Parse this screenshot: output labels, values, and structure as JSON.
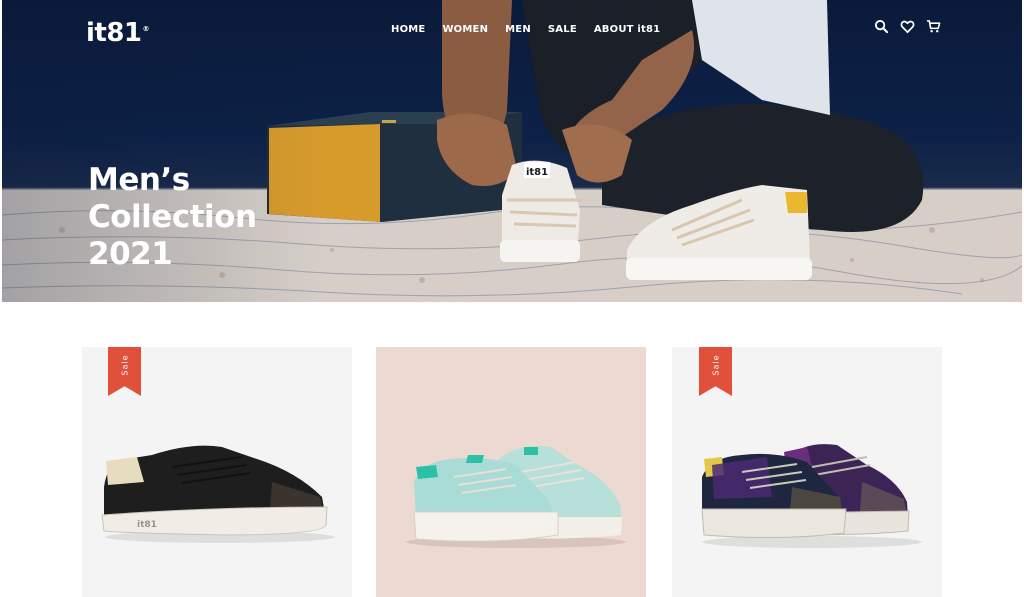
{
  "brand": {
    "logo": "it81",
    "reg": "®"
  },
  "nav": {
    "items": [
      {
        "label": "HOME"
      },
      {
        "label": "WOMEN"
      },
      {
        "label": "MEN"
      },
      {
        "label": "SALE"
      },
      {
        "label": "ABOUT it81"
      }
    ]
  },
  "header_icons": [
    "search-icon",
    "heart-icon",
    "cart-icon"
  ],
  "hero": {
    "title_line1": "Men’s",
    "title_line2": "Collection",
    "title_line3": "2021",
    "shoe_tag": "it81"
  },
  "products": [
    {
      "badge": "Sale",
      "shoe_tag": "it81",
      "colors": {
        "bg": "#f4f4f4",
        "upper": "#1e1e1e"
      }
    },
    {
      "badge": "",
      "colors": {
        "bg": "#ecd9d2",
        "upper": "#a9dcd6"
      }
    },
    {
      "badge": "Sale",
      "colors": {
        "bg": "#f4f4f4",
        "upper": "#1f2740"
      }
    }
  ],
  "colors": {
    "accent": "#e0503a",
    "hero_dark": "#0d2147"
  }
}
